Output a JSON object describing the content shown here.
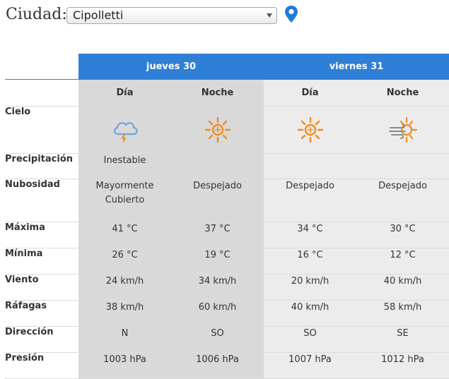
{
  "city": {
    "label": "Ciudad:",
    "selected": "Cipolletti"
  },
  "days": [
    {
      "name": "jueves 30",
      "periods": [
        "Día",
        "Noche"
      ]
    },
    {
      "name": "viernes 31",
      "periods": [
        "Día",
        "Noche"
      ]
    }
  ],
  "rows": [
    {
      "label": "Cielo",
      "icons": [
        "storm-cloud-icon",
        "sun-icon",
        "sun-icon",
        "sun-wind-icon"
      ]
    },
    {
      "label": "Precipitación",
      "values": [
        "Inestable",
        "",
        "",
        ""
      ]
    },
    {
      "label": "Nubosidad",
      "values": [
        "Mayormente Cubierto",
        "Despejado",
        "Despejado",
        "Despejado"
      ]
    },
    {
      "label": "Máxima",
      "values": [
        "41 °C",
        "37 °C",
        "34 °C",
        "30 °C"
      ]
    },
    {
      "label": "Mínima",
      "values": [
        "26 °C",
        "19 °C",
        "16 °C",
        "12 °C"
      ]
    },
    {
      "label": "Viento",
      "values": [
        "24 km/h",
        "34 km/h",
        "20 km/h",
        "40 km/h"
      ]
    },
    {
      "label": "Ráfagas",
      "values": [
        "38 km/h",
        "60 km/h",
        "40 km/h",
        "58 km/h"
      ]
    },
    {
      "label": "Dirección",
      "values": [
        "N",
        "SO",
        "SO",
        "SE"
      ]
    },
    {
      "label": "Presión",
      "values": [
        "1003 hPa",
        "1006 hPa",
        "1007 hPa",
        "1012 hPa"
      ]
    }
  ],
  "colors": {
    "header_blue": "#2f7fd6",
    "day1_bg": "#d9d9d9",
    "day2_bg": "#ececec",
    "sun_orange": "#f28a1e",
    "cloud_blue": "#6fa3e0",
    "pin_blue": "#1f7ad6"
  }
}
